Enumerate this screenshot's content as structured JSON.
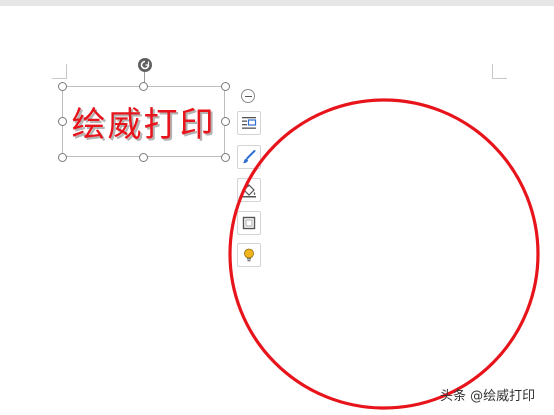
{
  "document": {
    "wordart_text": "绘威打印"
  },
  "shape": {
    "type": "circle",
    "stroke_color": "#e8141b"
  },
  "floating_toolbar": {
    "items": [
      "layout-options-icon",
      "shape-style-icon",
      "shape-fill-icon",
      "shape-outline-icon",
      "quick-tips-icon"
    ]
  },
  "watermark": {
    "text": "头条 @绘威打印"
  },
  "colors": {
    "accent_red": "#e8141b",
    "tool_blue": "#2f6fd1",
    "tip_yellow": "#f2b41c"
  }
}
